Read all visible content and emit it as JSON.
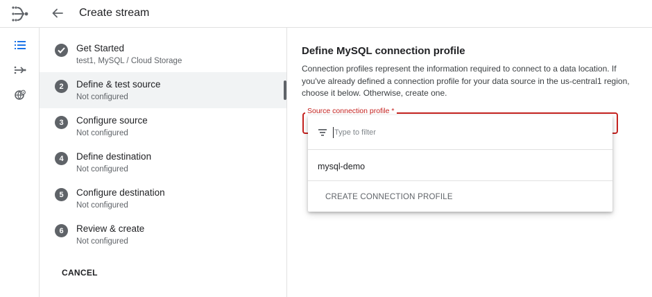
{
  "header": {
    "title": "Create stream",
    "logo_icon": "datastream-logo-icon",
    "back_icon": "arrow-back-icon"
  },
  "rail": {
    "items": [
      {
        "icon": "list-icon"
      },
      {
        "icon": "stream-arrow-icon"
      },
      {
        "icon": "globe-settings-icon"
      }
    ]
  },
  "steps": [
    {
      "number": "✓",
      "label": "Get Started",
      "sub": "test1, MySQL / Cloud Storage",
      "state": "done"
    },
    {
      "number": "2",
      "label": "Define & test source",
      "sub": "Not configured",
      "state": "active"
    },
    {
      "number": "3",
      "label": "Configure source",
      "sub": "Not configured",
      "state": "pending"
    },
    {
      "number": "4",
      "label": "Define destination",
      "sub": "Not configured",
      "state": "pending"
    },
    {
      "number": "5",
      "label": "Configure destination",
      "sub": "Not configured",
      "state": "pending"
    },
    {
      "number": "6",
      "label": "Review & create",
      "sub": "Not configured",
      "state": "pending"
    }
  ],
  "cancel_label": "CANCEL",
  "main": {
    "heading": "Define MySQL connection profile",
    "description": "Connection profiles represent the information required to connect to a data location. If you've already defined a connection profile for your data source in the us-central1 region, choose it below. Otherwise, create one.",
    "field_label": "Source connection profile *",
    "filter_placeholder": "Type to filter",
    "options": [
      "mysql-demo"
    ],
    "create_label": "CREATE CONNECTION PROFILE"
  },
  "colors": {
    "error": "#c5221f",
    "step_badge": "#5f6368",
    "active_bg": "#f1f3f4"
  }
}
